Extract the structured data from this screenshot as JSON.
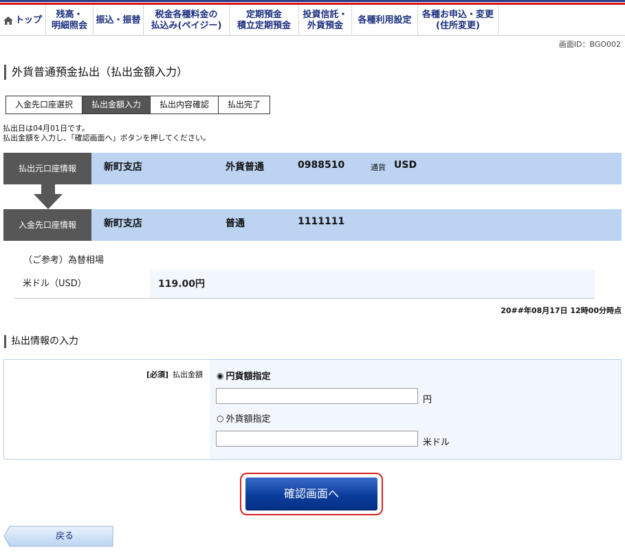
{
  "nav": {
    "home": "トップ",
    "items": [
      {
        "label": "残高・\n明細照会",
        "w": 69
      },
      {
        "label": "振込・振替",
        "w": 73
      },
      {
        "label": "税金各種料金の\n払込み(ペイジー)",
        "w": 125
      },
      {
        "label": "定期預金\n積立定期預金",
        "w": 101
      },
      {
        "label": "投資信託・\n外貨預金",
        "w": 77
      },
      {
        "label": "各種利用設定",
        "w": 96
      },
      {
        "label": "各種お申込・変更\n(住所変更)",
        "w": 117
      }
    ]
  },
  "screen_id": "画面ID：BGO002",
  "title": "外貨普通預金払出（払出金額入力）",
  "steps": [
    "入金先口座選択",
    "払出金額入力",
    "払出内容確認",
    "払出完了"
  ],
  "active_step": 1,
  "desc": {
    "line1": "払出日は04月01日です。",
    "line2": "払出金額を入力し、「確認画面へ」ボタンを押してください。"
  },
  "from_account": {
    "label": "払出元口座情報",
    "branch": "新町支店",
    "type": "外貨普通",
    "number": "0988510",
    "currency_label": "通貨",
    "currency": "USD"
  },
  "to_account": {
    "label": "入金先口座情報",
    "branch": "新町支店",
    "type": "普通",
    "number": "1111111"
  },
  "reference": {
    "title": "（ご参考）為替相場",
    "currency": "米ドル（USD）",
    "rate": "119.00円"
  },
  "as_of": "20##年08月17日 12時00分時点",
  "input_section": {
    "title": "払出情報の入力",
    "required": "[必須]",
    "field_label": "払出金額",
    "option_yen": "円貨額指定",
    "option_fx": "外貨額指定",
    "unit_yen": "円",
    "unit_fx": "米ドル",
    "yen_value": "",
    "fx_value": ""
  },
  "buttons": {
    "confirm": "確認画面へ",
    "back": "戻る"
  },
  "colors": {
    "nav_text": "#1b2f7e",
    "account_bg": "#bcd4f2",
    "label_bg": "#575757",
    "confirm_btn": "#0b3d9e",
    "highlight_border": "#d8201f"
  }
}
